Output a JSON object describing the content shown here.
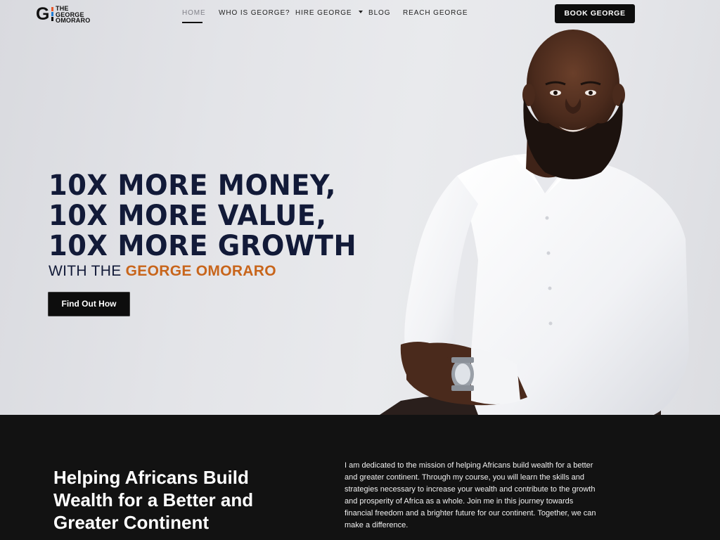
{
  "header": {
    "logo": {
      "initial": "G",
      "lines": [
        "THE",
        "GEORGE",
        "OMORARO"
      ]
    },
    "nav": [
      {
        "label": "HOME",
        "active": true
      },
      {
        "label": "WHO IS GEORGE?"
      },
      {
        "label": "HIRE GEORGE",
        "dropdown": true
      },
      {
        "label": "BLOG"
      },
      {
        "label": "REACH GEORGE"
      }
    ],
    "book_button": "BOOK GEORGE"
  },
  "hero": {
    "headline": [
      "10X MORE MONEY,",
      "10X MORE VALUE,",
      "10X MORE GROWTH"
    ],
    "sub_prefix": "WITH THE",
    "sub_accent": "GEORGE OMORARO",
    "cta": "Find Out How",
    "colors": {
      "headline": "#121a38",
      "accent": "#c8651b"
    }
  },
  "mission": {
    "title": [
      "Helping Africans Build",
      "Wealth for a Better and",
      "Greater Continent"
    ],
    "body": [
      "I am dedicated to the mission of helping Africans build wealth for a better",
      "and greater continent. Through my course, you will learn the skills and",
      "strategies necessary to increase your wealth and contribute to the growth",
      "and prosperity of Africa as a whole. Join me in this journey towards",
      "financial freedom and a brighter future for our continent. Together, we can",
      "make a difference."
    ]
  }
}
